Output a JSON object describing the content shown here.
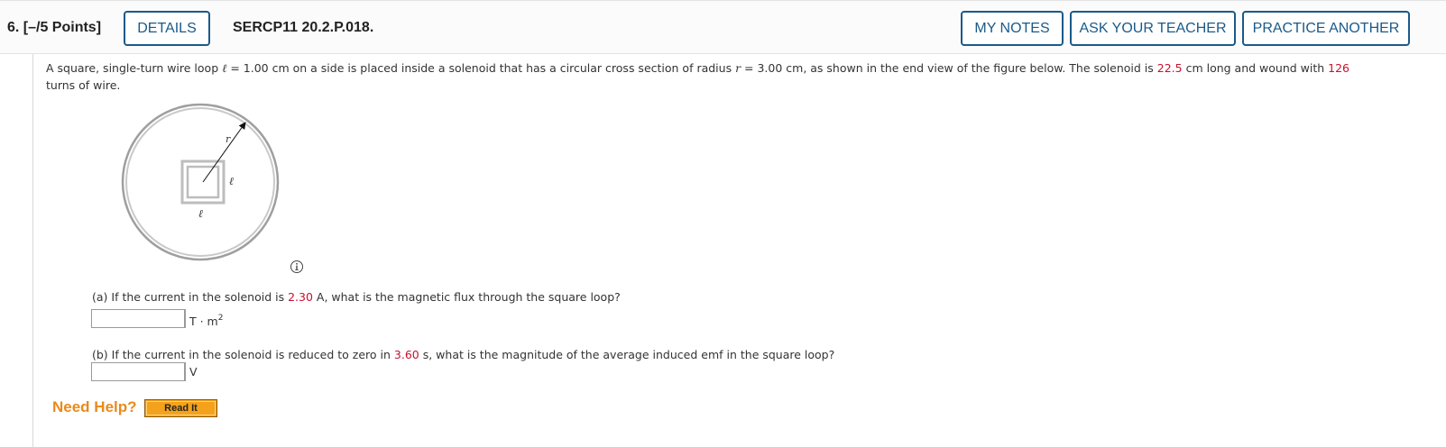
{
  "header": {
    "question_label": "6. [–/5 Points]",
    "details_label": "DETAILS",
    "problem_code": "SERCP11 20.2.P.018.",
    "my_notes_label": "MY NOTES",
    "ask_teacher_label": "ASK YOUR TEACHER",
    "practice_label": "PRACTICE ANOTHER"
  },
  "problem": {
    "t1": "A square, single-turn wire loop ",
    "ell_symbol": "ℓ",
    "t2": " = 1.00 cm on a side is placed inside a solenoid that has a circular cross section of radius ",
    "r_symbol": "r",
    "t3": " = 3.00 cm, as shown in the end view of the figure below. The solenoid is ",
    "length_value": "22.5",
    "t4": " cm long and wound with ",
    "turns_value": "126",
    "t5": " turns of wire."
  },
  "figure": {
    "r_label": "r",
    "ell_side_label": "ℓ",
    "ell_bottom_label": "ℓ"
  },
  "part_a": {
    "t1": "(a) If the current in the solenoid is ",
    "current_value": "2.30",
    "t2": " A, what is the magnetic flux through the square loop?",
    "answer_value": "",
    "unit_base": "T · m",
    "unit_exp": "2"
  },
  "part_b": {
    "t1": "(b) If the current in the solenoid is reduced to zero in ",
    "time_value": "3.60",
    "t2": " s, what is the magnitude of the average induced emf in the square loop?",
    "answer_value": "",
    "unit": "V"
  },
  "help": {
    "need_help_label": "Need Help?",
    "read_it_label": "Read It"
  },
  "colors": {
    "accent": "#1a5a8a",
    "given_value": "#c8102e",
    "help": "#ea8a1c",
    "read_it_bg": "#f4a21c"
  }
}
